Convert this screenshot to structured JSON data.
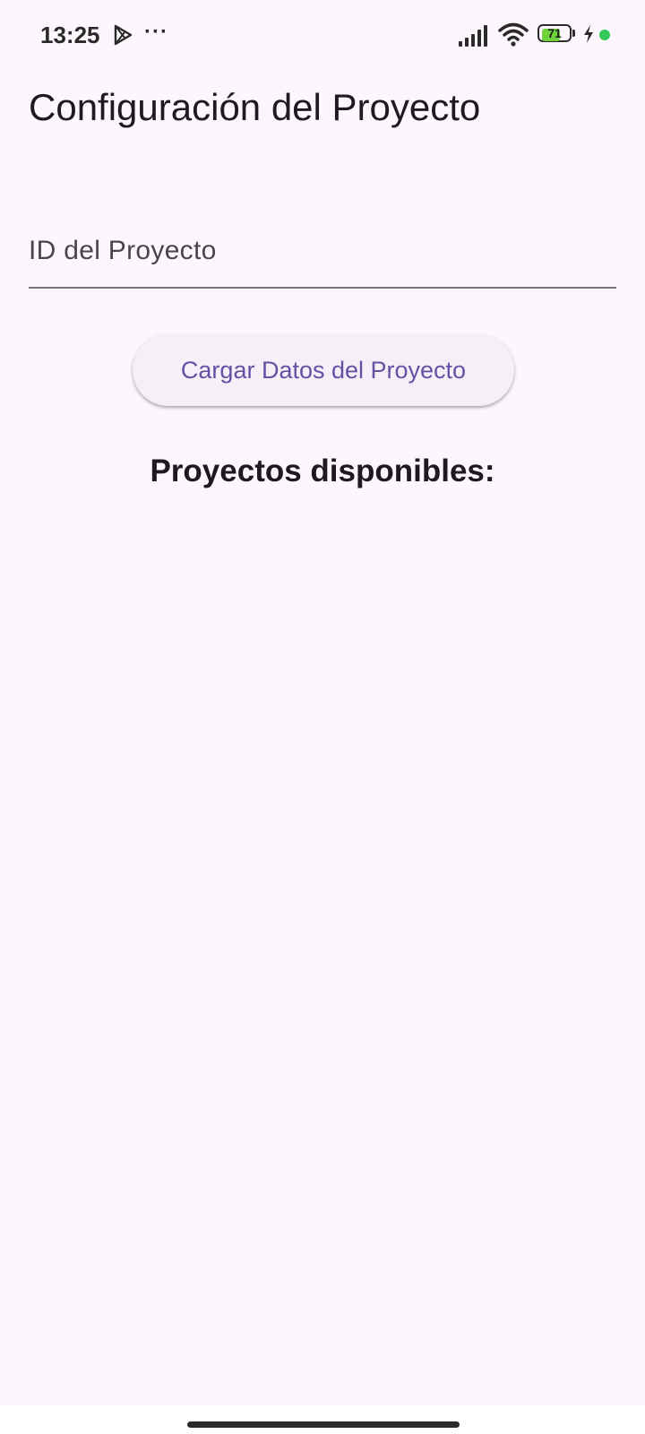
{
  "status_bar": {
    "time": "13:25",
    "more": "···",
    "battery_level": "71",
    "battery_percent": 71,
    "icons": [
      "play-store-icon",
      "more-icon",
      "signal-icon",
      "wifi-icon",
      "battery-icon",
      "charging-bolt-icon",
      "privacy-dot-indicator"
    ],
    "colors": {
      "battery_fill": "#6fd33b",
      "indicator_dot": "#34c759"
    }
  },
  "app_bar": {
    "title": "Configuración del Proyecto"
  },
  "form": {
    "project_id_placeholder": "ID del Proyecto",
    "project_id_value": "",
    "load_button_label": "Cargar Datos del Proyecto"
  },
  "projects": {
    "heading": "Proyectos disponibles:",
    "items": []
  },
  "colors": {
    "background": "#fdf7fd",
    "primary": "#6750a4",
    "button_surface": "#f5f0f8",
    "text": "#1d1b20",
    "field_underline": "#79747e"
  }
}
